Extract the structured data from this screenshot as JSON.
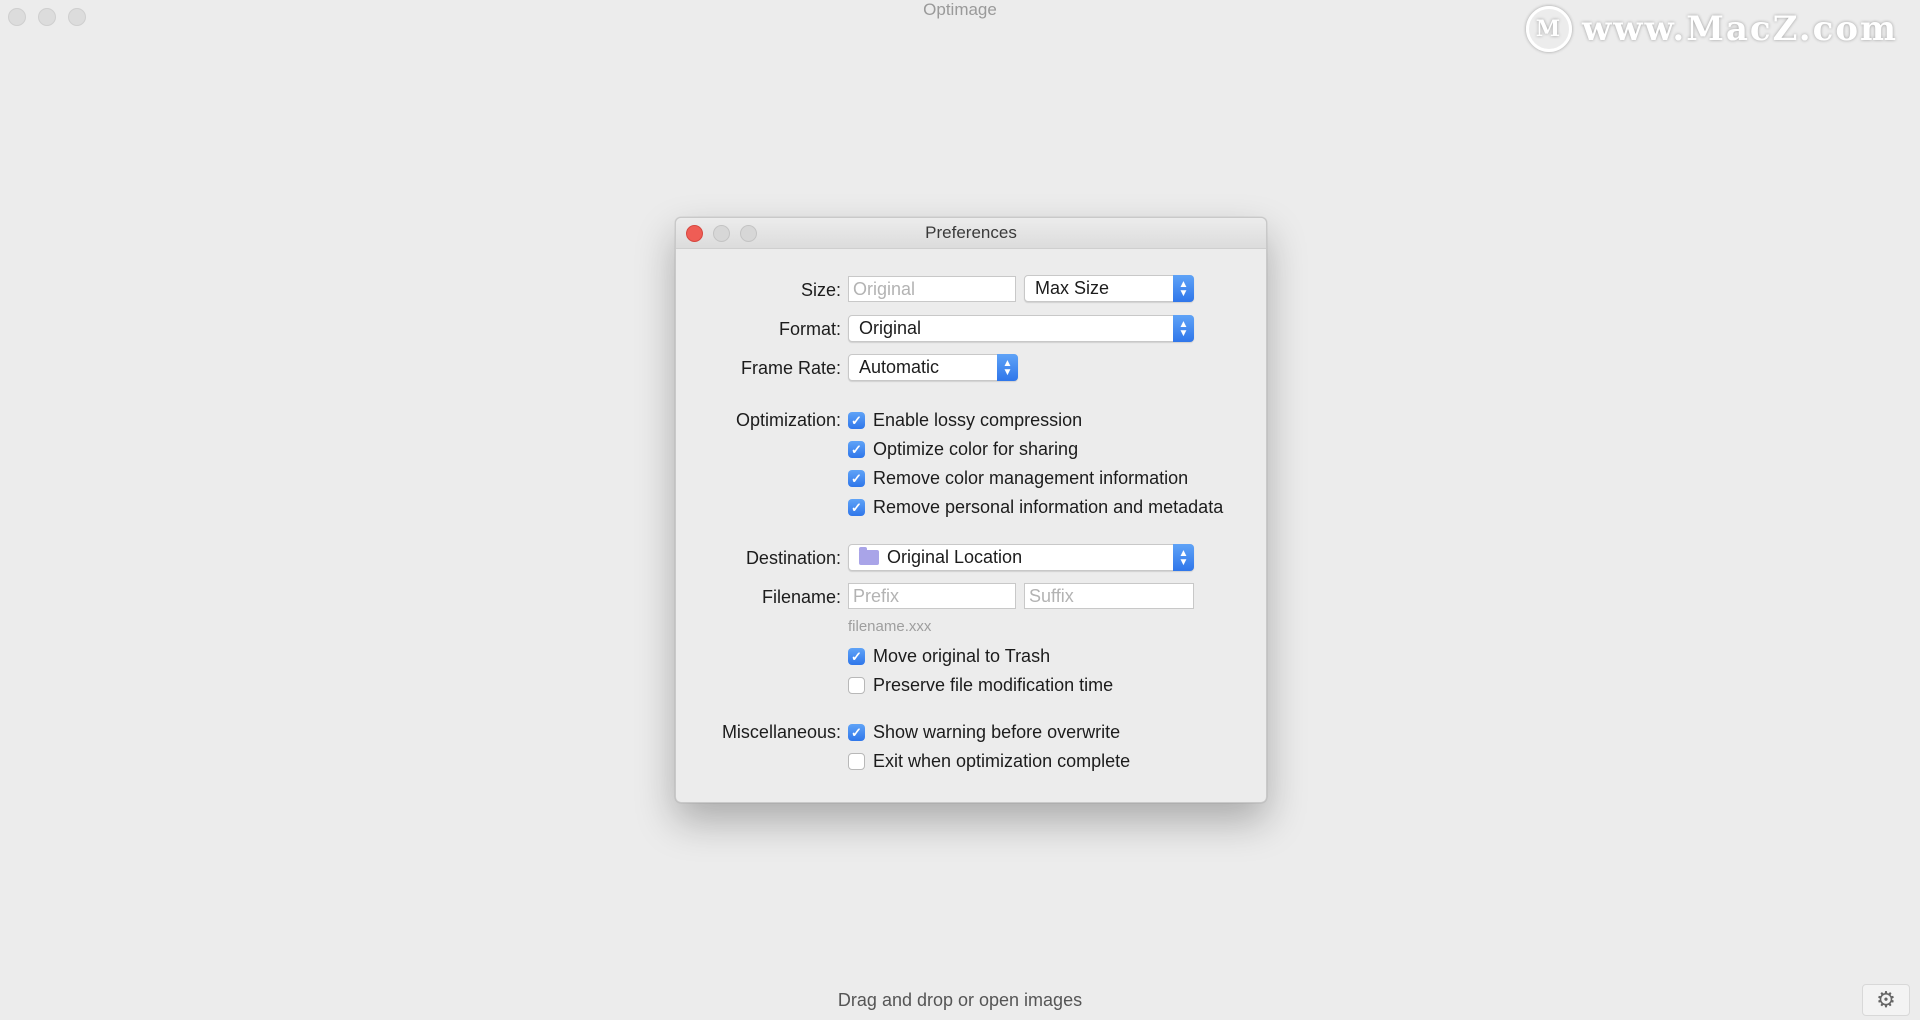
{
  "app": {
    "title": "Optimage",
    "watermark": "www.MacZ.com",
    "drop_hint": "Drag and drop or open images",
    "settings_icon": "gear-icon"
  },
  "prefs": {
    "title": "Preferences",
    "size": {
      "label": "Size:",
      "placeholder": "Original",
      "mode": "Max Size"
    },
    "format": {
      "label": "Format:",
      "value": "Original"
    },
    "frame_rate": {
      "label": "Frame Rate:",
      "value": "Automatic"
    },
    "optimization": {
      "label": "Optimization:",
      "options": [
        {
          "label": "Enable lossy compression",
          "checked": true
        },
        {
          "label": "Optimize color for sharing",
          "checked": true
        },
        {
          "label": "Remove color management information",
          "checked": true
        },
        {
          "label": "Remove personal information and metadata",
          "checked": true
        }
      ]
    },
    "destination": {
      "label": "Destination:",
      "value": "Original Location"
    },
    "filename": {
      "label": "Filename:",
      "prefix_placeholder": "Prefix",
      "suffix_placeholder": "Suffix",
      "hint": "filename.xxx",
      "options": [
        {
          "label": "Move original to Trash",
          "checked": true
        },
        {
          "label": "Preserve file modification time",
          "checked": false
        }
      ]
    },
    "misc": {
      "label": "Miscellaneous:",
      "options": [
        {
          "label": "Show warning before overwrite",
          "checked": true
        },
        {
          "label": "Exit when optimization complete",
          "checked": false
        }
      ]
    }
  }
}
